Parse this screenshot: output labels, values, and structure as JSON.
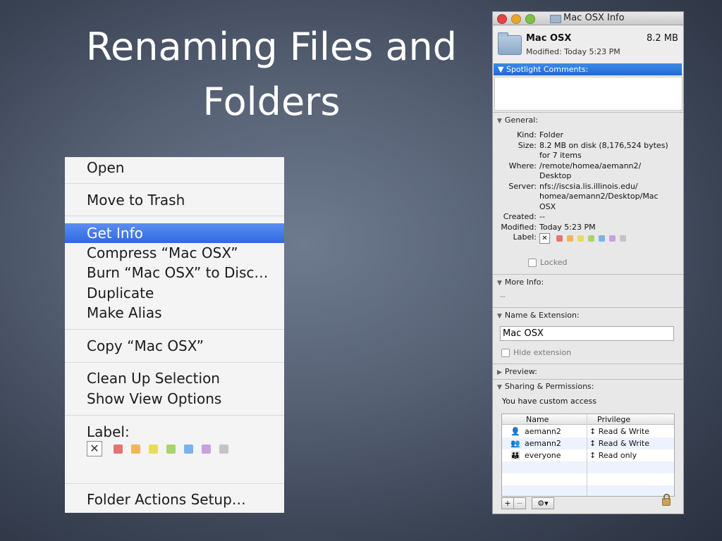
{
  "slide": {
    "title_line1": "Renaming Files and",
    "title_line2": "Folders"
  },
  "context_menu": {
    "items": [
      {
        "label": "Open"
      },
      {
        "label": "Move to Trash"
      },
      {
        "label": "Get Info",
        "highlighted": true
      },
      {
        "label": "Compress “Mac OSX”"
      },
      {
        "label": "Burn “Mac OSX” to Disc…"
      },
      {
        "label": "Duplicate"
      },
      {
        "label": "Make Alias"
      },
      {
        "label": "Copy “Mac OSX”"
      },
      {
        "label": "Clean Up Selection"
      },
      {
        "label": "Show View Options"
      },
      {
        "label": "Label:"
      },
      {
        "label": "Folder Actions Setup…"
      }
    ],
    "label_colors": [
      "#e57373",
      "#f0b75a",
      "#eadc5a",
      "#a8d46a",
      "#7ab3ea",
      "#c7a2de",
      "#c4c4c4"
    ],
    "highlight_color": "#3a77e4"
  },
  "info_window": {
    "title": "Mac OSX Info",
    "name": "Mac OSX",
    "size": "8.2 MB",
    "modified": "Modified: Today 5:23 PM",
    "spotlight_header": "Spotlight Comments:",
    "general_header": "General:",
    "general": {
      "kind_label": "Kind:",
      "kind_value": "Folder",
      "size_label": "Size:",
      "size_line1": "8.2 MB on disk (8,176,524 bytes)",
      "size_line2": "for 7 items",
      "where_label": "Where:",
      "where_line1": "/remote/homea/aemann2/",
      "where_line2": "Desktop",
      "server_label": "Server:",
      "server_line1": "nfs://iscsia.lis.illinois.edu/",
      "server_line2": "homea/aemann2/Desktop/Mac",
      "server_line3": "OSX",
      "created_label": "Created:",
      "created_value": "--",
      "modified_label": "Modified:",
      "modified_value": "Today 5:23 PM",
      "label_label": "Label:",
      "locked_label": "Locked"
    },
    "more_info_header": "More Info:",
    "more_info_value": "--",
    "name_ext_header": "Name & Extension:",
    "name_field_value": "Mac OSX",
    "hide_extension_label": "Hide extension",
    "preview_header": "Preview:",
    "sharing_header": "Sharing & Permissions:",
    "access_text": "You have custom access",
    "table": {
      "col_name": "Name",
      "col_privilege": "Privilege",
      "rows": [
        {
          "icon": "user-icon",
          "name": "aemann2",
          "privilege": "Read & Write"
        },
        {
          "icon": "group-icon",
          "name": "aemann2",
          "privilege": "Read & Write"
        },
        {
          "icon": "everyone-icon",
          "name": "everyone",
          "privilege": "Read only"
        }
      ]
    },
    "buttons": {
      "add": "+",
      "remove": "−",
      "action": "⚙▾"
    },
    "spotlight_color": "#2f78e0"
  }
}
